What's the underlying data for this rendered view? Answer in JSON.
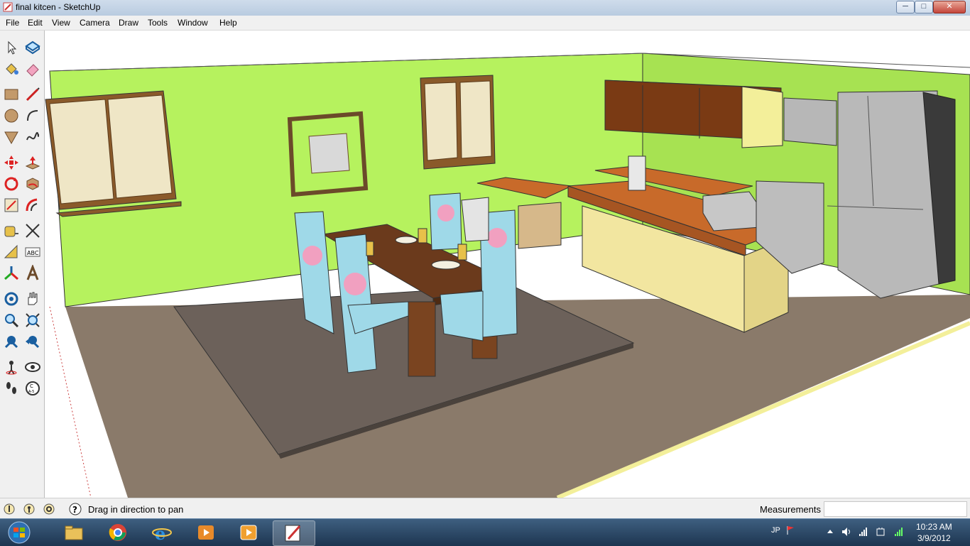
{
  "window": {
    "title": "final kitcen - SketchUp",
    "minimize": "─",
    "maximize": "□",
    "close": "✕"
  },
  "menu": [
    {
      "label": "File"
    },
    {
      "label": "Edit"
    },
    {
      "label": "View"
    },
    {
      "label": "Camera"
    },
    {
      "label": "Draw"
    },
    {
      "label": "Tools"
    },
    {
      "label": "Window"
    },
    {
      "label": "Help"
    }
  ],
  "tools": [
    "select-icon",
    "component-icon",
    "paint-bucket-icon",
    "eraser-icon",
    "rectangle-icon",
    "line-icon",
    "circle-icon",
    "arc-icon",
    "polygon-icon",
    "freehand-icon",
    "move-icon",
    "push-pull-icon",
    "rotate-icon",
    "follow-me-icon",
    "scale-icon",
    "offset-icon",
    "tape-measure-icon",
    "dimension-icon",
    "protractor-icon",
    "text-icon",
    "axes-icon",
    "3d-text-icon",
    "orbit-icon",
    "pan-icon",
    "zoom-icon",
    "zoom-window-icon",
    "zoom-extents-icon",
    "previous-view-icon",
    "position-camera-icon",
    "look-around-icon",
    "walk-icon",
    "section-plane-icon"
  ],
  "toolbar_text": {
    "abc": "ABC",
    "section": "C\nA-5"
  },
  "status": {
    "message": "Drag in direction to pan",
    "measurements_label": "Measurements",
    "measurements_value": ""
  },
  "taskbar": {
    "apps": [
      "windows-explorer-icon",
      "chrome-icon",
      "internet-explorer-icon",
      "media-player-icon",
      "vlc-icon",
      "sketchup-icon"
    ],
    "lang": "JP",
    "time": "10:23 AM",
    "date": "3/9/2012"
  },
  "colors": {
    "wall": "#b6f25e",
    "floor": "#8a7a6a",
    "rug": "#6c615a",
    "counter": "#c86a2a",
    "cabinet": "#7a3a14"
  }
}
